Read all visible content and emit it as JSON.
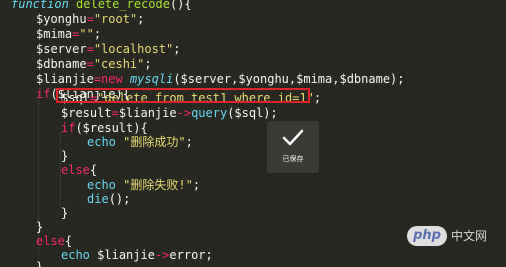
{
  "code": {
    "line1": {
      "kw": "function",
      "name": "delete_recode",
      "rest": "(){"
    },
    "line2": {
      "var": "$yonghu",
      "eq": "=",
      "str": "\"root\"",
      "end": ";"
    },
    "line3": {
      "var": "$mima",
      "eq": "=",
      "str": "\"\"",
      "end": ";"
    },
    "line4": {
      "var": "$server",
      "eq": "=",
      "str": "\"localhost\"",
      "end": ";"
    },
    "line5": {
      "var": "$dbname",
      "eq": "=",
      "str": "\"ceshi\"",
      "end": ";"
    },
    "line6": {
      "var": "$lianjie",
      "eq": "=",
      "kw": "new",
      "cls": "mysqli",
      "args": "($server,$yonghu,$mima,$dbname);"
    },
    "line7": {
      "kw": "if",
      "rest": "($lianjie){"
    },
    "line8": {
      "var": "$sql",
      "eq": "=",
      "str": "\"delete from test1 where id=1\"",
      "end": ";"
    },
    "line9": {
      "var": "$result",
      "eq": "=",
      "obj": "$lianjie",
      "arrow": "->",
      "method": "query",
      "args": "($sql);"
    },
    "line10": {
      "kw": "if",
      "rest": "($result){"
    },
    "line11": {
      "kw": "echo",
      "str": "\"删除成功\"",
      "end": ";"
    },
    "line12": {
      "text": "}"
    },
    "line13": {
      "kw": "else",
      "rest": "{"
    },
    "line14": {
      "kw": "echo",
      "str": "\"删除失败!\"",
      "end": ";"
    },
    "line15": {
      "fn": "die",
      "rest": "();"
    },
    "line16": {
      "text": "}"
    },
    "line17": {
      "text": "}"
    },
    "line18": {
      "kw": "else",
      "rest": "{"
    },
    "line19": {
      "kw": "echo",
      "var": "$lianjie",
      "arrow": "->",
      "prop": "error",
      "end": ";"
    },
    "line20": {
      "text": "}"
    }
  },
  "toast": {
    "label": "已保存",
    "icon": "checkmark-icon"
  },
  "watermark": {
    "logo": "php",
    "text": "中文网"
  },
  "colors": {
    "background": "#272822",
    "highlight_border": "#e0222a",
    "keyword": "#66d9ef",
    "control": "#f92672",
    "string": "#e6db74"
  }
}
